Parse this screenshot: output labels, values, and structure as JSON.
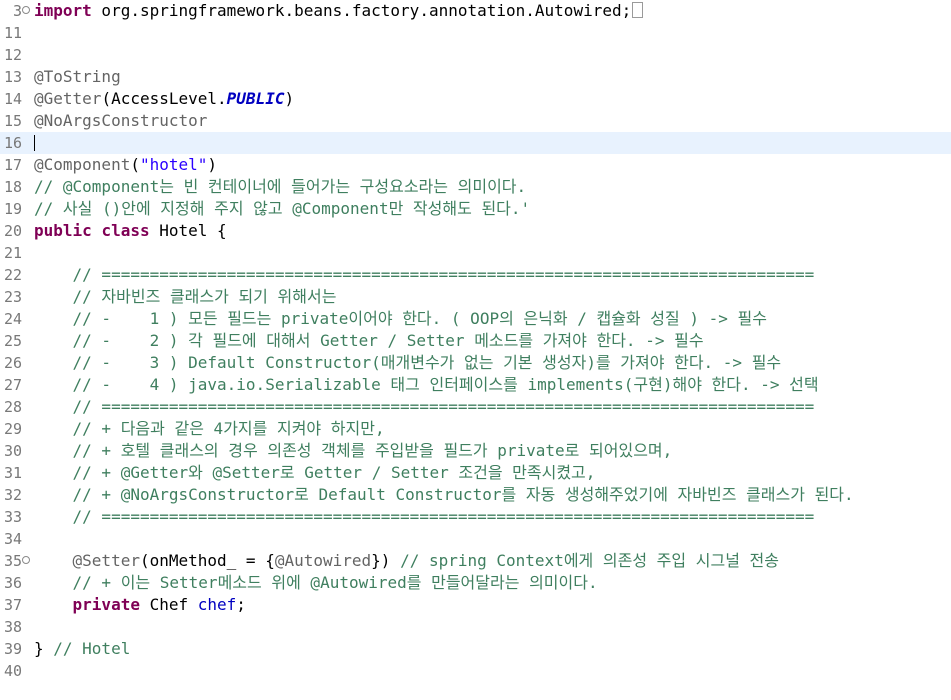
{
  "editor": {
    "lines": [
      {
        "n": "3",
        "fold": "⊕",
        "code": "import org.springframework.beans.factory.annotation.Autowired;"
      },
      {
        "n": "11",
        "code": ""
      },
      {
        "n": "12",
        "code": ""
      },
      {
        "n": "13",
        "code": "@ToString"
      },
      {
        "n": "14",
        "code": "@Getter(AccessLevel.PUBLIC)"
      },
      {
        "n": "15",
        "code": "@NoArgsConstructor"
      },
      {
        "n": "16",
        "code": ""
      },
      {
        "n": "17",
        "code": "@Component(\"hotel\")"
      },
      {
        "n": "18",
        "code": "// @Component는 빈 컨테이너에 들어가는 구성요소라는 의미이다."
      },
      {
        "n": "19",
        "code": "// 사실 ()안에 지정해 주지 않고 @Component만 작성해도 된다.'"
      },
      {
        "n": "20",
        "code": "public class Hotel {"
      },
      {
        "n": "21",
        "code": ""
      },
      {
        "n": "22",
        "code": "    // =========================================================================="
      },
      {
        "n": "23",
        "code": "    // 자바빈즈 클래스가 되기 위해서는"
      },
      {
        "n": "24",
        "code": "    // -    1 ) 모든 필드는 private이어야 한다. ( OOP의 은닉화 / 캡슐화 성질 ) -> 필수"
      },
      {
        "n": "25",
        "code": "    // -    2 ) 각 필드에 대해서 Getter / Setter 메소드를 가져야 한다. -> 필수"
      },
      {
        "n": "26",
        "code": "    // -    3 ) Default Constructor(매개변수가 없는 기본 생성자)를 가져야 한다. -> 필수"
      },
      {
        "n": "27",
        "code": "    // -    4 ) java.io.Serializable 태그 인터페이스를 implements(구현)해야 한다. -> 선택"
      },
      {
        "n": "28",
        "code": "    // =========================================================================="
      },
      {
        "n": "29",
        "code": "    // + 다음과 같은 4가지를 지켜야 하지만,"
      },
      {
        "n": "30",
        "code": "    // + 호텔 클래스의 경우 의존성 객체를 주입받을 필드가 private로 되어있으며,"
      },
      {
        "n": "31",
        "code": "    // + @Getter와 @Setter로 Getter / Setter 조건을 만족시켰고,"
      },
      {
        "n": "32",
        "code": "    // + @NoArgsConstructor로 Default Constructor를 자동 생성해주었기에 자바빈즈 클래스가 된다."
      },
      {
        "n": "33",
        "code": "    // =========================================================================="
      },
      {
        "n": "34",
        "code": ""
      },
      {
        "n": "35",
        "fold": "⊖",
        "code": "    @Setter(onMethod_ = {@Autowired}) // spring Context에게 의존성 주입 시그널 전송"
      },
      {
        "n": "36",
        "code": "    // + 이는 Setter메소드 위에 @Autowired를 만들어달라는 의미이다."
      },
      {
        "n": "37",
        "code": "    private Chef chef;"
      },
      {
        "n": "38",
        "code": ""
      },
      {
        "n": "39",
        "code": "} // Hotel"
      },
      {
        "n": "40",
        "code": ""
      }
    ],
    "current_line": "16"
  }
}
